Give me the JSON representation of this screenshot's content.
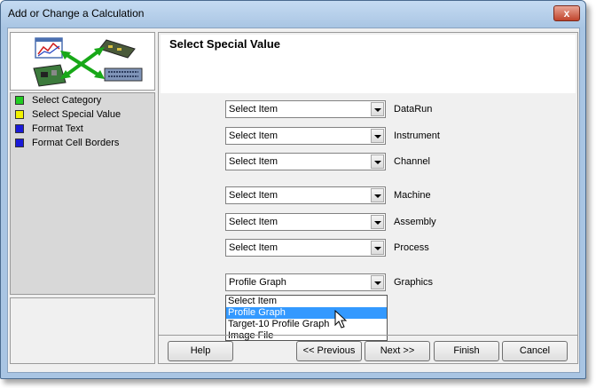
{
  "window": {
    "title": "Add or Change a Calculation",
    "close_label": "x"
  },
  "steps": [
    {
      "label": "Select Category",
      "color": "#22cc22"
    },
    {
      "label": "Select Special Value",
      "color": "#f2f200"
    },
    {
      "label": "Format Text",
      "color": "#1a1ad8"
    },
    {
      "label": "Format Cell Borders",
      "color": "#1a1ad8"
    }
  ],
  "panel": {
    "title": "Select Special Value"
  },
  "fields": [
    {
      "value": "Select Item",
      "label": "DataRun"
    },
    {
      "value": "Select Item",
      "label": "Instrument"
    },
    {
      "value": "Select Item",
      "label": "Channel"
    },
    {
      "value": "Select Item",
      "label": "Machine"
    },
    {
      "value": "Select Item",
      "label": "Assembly"
    },
    {
      "value": "Select Item",
      "label": "Process"
    },
    {
      "value": "Profile Graph",
      "label": "Graphics"
    }
  ],
  "graphics_options": [
    {
      "label": "Select Item",
      "selected": false
    },
    {
      "label": "Profile Graph",
      "selected": true
    },
    {
      "label": "Target-10 Profile Graph",
      "selected": false
    },
    {
      "label": "Image File",
      "selected": false
    }
  ],
  "buttons": {
    "help": "Help",
    "previous": "<< Previous",
    "next": "Next >>",
    "finish": "Finish",
    "cancel": "Cancel"
  }
}
